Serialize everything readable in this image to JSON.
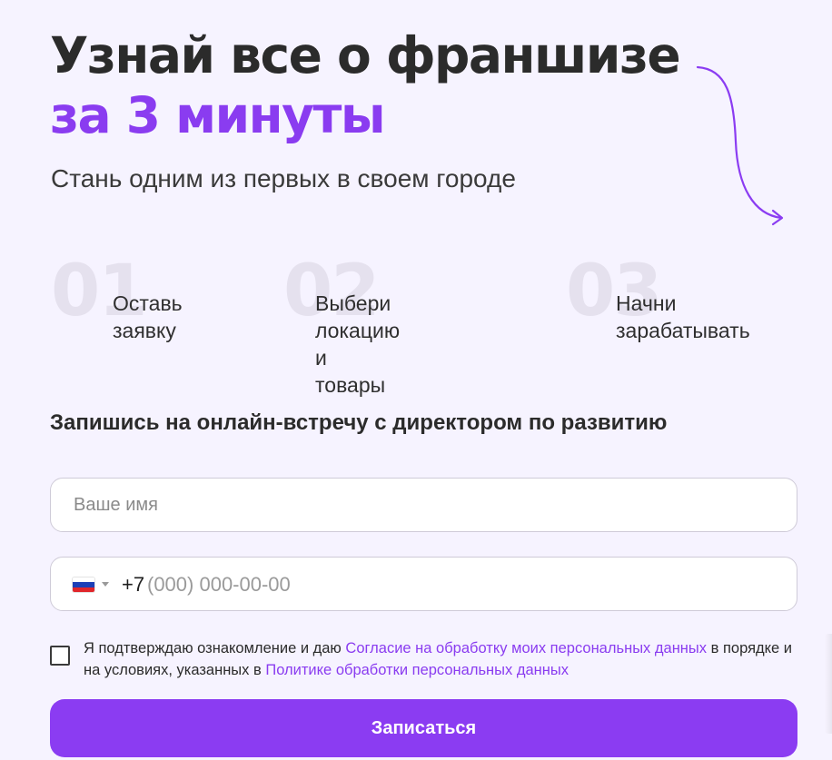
{
  "headline": {
    "line1": "Узнай все о франшизе",
    "line2": "за 3 минуты"
  },
  "subtitle": "Стань одним из первых в своем городе",
  "steps": [
    {
      "number": "01",
      "label": "Оставь\nзаявку"
    },
    {
      "number": "02",
      "label": "Выбери локацию\nи товары"
    },
    {
      "number": "03",
      "label": "Начни\nзарабатывать"
    }
  ],
  "form": {
    "title": "Запишись на онлайн-встречу с директором по развитию",
    "name_placeholder": "Ваше имя",
    "phone_code": "+7",
    "phone_placeholder": "(000) 000-00-00",
    "consent": {
      "text1": "Я подтверждаю ознакомление и даю ",
      "link1": "Согласие на обработку моих персональных данных",
      "text2": " в порядке и на условиях, указанных в ",
      "link2": "Политике обработки персональных данных"
    },
    "submit_label": "Записаться"
  },
  "colors": {
    "accent": "#8b3cf2",
    "background": "#f6f3ff",
    "step_number": "#e5e1ee"
  },
  "icons": {
    "arrow": "curved-arrow-icon",
    "flag": "russia-flag-icon",
    "caret": "chevron-down-icon"
  }
}
